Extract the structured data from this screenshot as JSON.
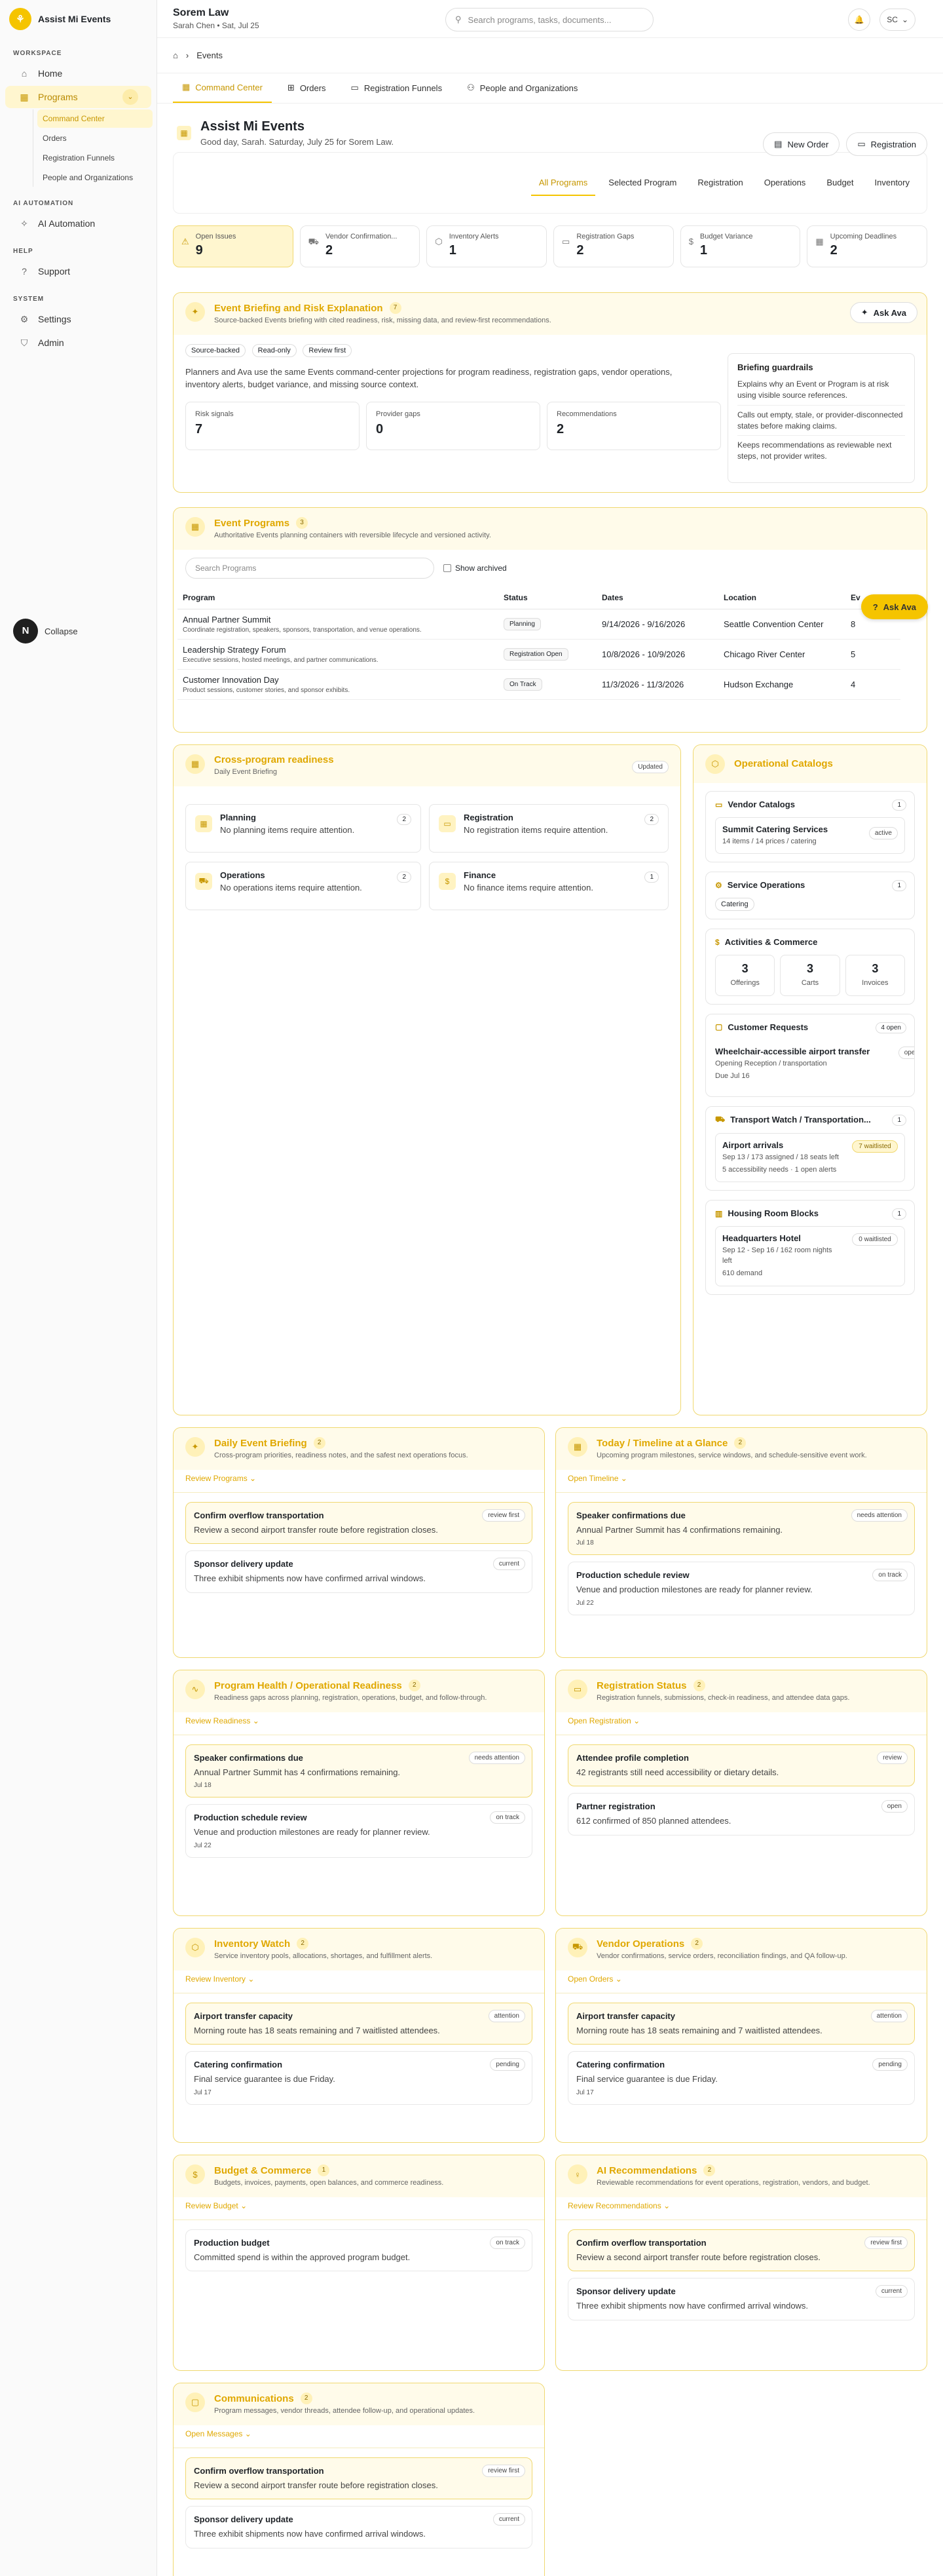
{
  "brand": "Assist Mi Events",
  "sidebar": {
    "sections": [
      "WORKSPACE",
      "AI AUTOMATION",
      "HELP",
      "SYSTEM"
    ],
    "items": [
      {
        "label": "Home",
        "icon": "home-icon"
      },
      {
        "label": "Programs",
        "icon": "calendar-icon"
      },
      {
        "label": "AI Automation",
        "icon": "ai-icon"
      },
      {
        "label": "Support",
        "icon": "help-icon"
      },
      {
        "label": "Settings",
        "icon": "gear-icon"
      },
      {
        "label": "Admin",
        "icon": "shield-icon"
      }
    ],
    "sub": [
      "Command Center",
      "Orders",
      "Registration Funnels",
      "People and Organizations"
    ],
    "collapse": "Collapse",
    "collapse_badge": "N"
  },
  "topbar": {
    "org": "Sorem Law",
    "user_date": "Sarah Chen • Sat, Jul 25",
    "search_placeholder": "Search programs, tasks, documents...",
    "avatar": "SC"
  },
  "breadcrumb": {
    "current": "Events"
  },
  "tabs": [
    "Command Center",
    "Orders",
    "Registration Funnels",
    "People and Organizations"
  ],
  "hero": {
    "title": "Assist Mi Events",
    "subtitle": "Good day, Sarah. Saturday, July 25 for Sorem Law.",
    "new_order": "New Order",
    "registration": "Registration"
  },
  "filters": [
    "All Programs",
    "Selected Program",
    "Registration",
    "Operations",
    "Budget",
    "Inventory"
  ],
  "kpis": [
    {
      "label": "Open Issues",
      "value": "9"
    },
    {
      "label": "Vendor Confirmation...",
      "value": "2"
    },
    {
      "label": "Inventory Alerts",
      "value": "1"
    },
    {
      "label": "Registration Gaps",
      "value": "2"
    },
    {
      "label": "Budget Variance",
      "value": "1"
    },
    {
      "label": "Upcoming Deadlines",
      "value": "2"
    }
  ],
  "briefing": {
    "title": "Event Briefing and Risk Explanation",
    "count": "7",
    "subtitle": "Source-backed Events briefing with cited readiness, risk, missing data, and review-first recommendations.",
    "ask": "Ask Ava",
    "chips": [
      "Source-backed",
      "Read-only",
      "Review first"
    ],
    "body": "Planners and Ava use the same Events command-center projections for program readiness, registration gaps, vendor operations, inventory alerts, budget variance, and missing source context.",
    "stats": [
      {
        "label": "Risk signals",
        "value": "7"
      },
      {
        "label": "Provider gaps",
        "value": "0"
      },
      {
        "label": "Recommendations",
        "value": "2"
      }
    ],
    "guardrails": {
      "title": "Briefing guardrails",
      "lines": [
        "Explains why an Event or Program is at risk using visible source references.",
        "Calls out empty, stale, or provider-disconnected states before making claims.",
        "Keeps recommendations as reviewable next steps, not provider writes."
      ]
    }
  },
  "programs": {
    "title": "Event Programs",
    "count": "3",
    "subtitle": "Authoritative Events planning containers with reversible lifecycle and versioned activity.",
    "search_placeholder": "Search Programs",
    "show_archived": "Show archived",
    "ask": "Ask Ava",
    "columns": [
      "Program",
      "Status",
      "Dates",
      "Location",
      "Ev"
    ],
    "rows": [
      {
        "name": "Annual Partner Summit",
        "desc": "Coordinate registration, speakers, sponsors, transportation, and venue operations.",
        "status": "Planning",
        "dates": "9/14/2026 - 9/16/2026",
        "location": "Seattle Convention Center",
        "events": "8"
      },
      {
        "name": "Leadership Strategy Forum",
        "desc": "Executive sessions, hosted meetings, and partner communications.",
        "status": "Registration Open",
        "dates": "10/8/2026 - 10/9/2026",
        "location": "Chicago River Center",
        "events": "5"
      },
      {
        "name": "Customer Innovation Day",
        "desc": "Product sessions, customer stories, and sponsor exhibits.",
        "status": "On Track",
        "dates": "11/3/2026 - 11/3/2026",
        "location": "Hudson Exchange",
        "events": "4"
      }
    ]
  },
  "readiness": {
    "title": "Cross-program readiness",
    "subtitle": "Daily Event Briefing",
    "badge": "Updated",
    "tiles": [
      {
        "title": "Planning",
        "desc": "No planning items require attention.",
        "count": "2"
      },
      {
        "title": "Registration",
        "desc": "No registration items require attention.",
        "count": "2"
      },
      {
        "title": "Operations",
        "desc": "No operations items require attention.",
        "count": "2"
      },
      {
        "title": "Finance",
        "desc": "No finance items require attention.",
        "count": "1"
      }
    ]
  },
  "catalogs": {
    "title": "Operational Catalogs",
    "vendor": {
      "title": "Vendor Catalogs",
      "n": "1",
      "item": "Summit Catering Services",
      "meta": "14 items / 14 prices / catering",
      "status": "active"
    },
    "service": {
      "title": "Service Operations",
      "n": "1",
      "chip": "Catering"
    },
    "commerce": {
      "title": "Activities & Commerce",
      "stats": [
        {
          "v": "3",
          "l": "Offerings"
        },
        {
          "v": "3",
          "l": "Carts"
        },
        {
          "v": "3",
          "l": "Invoices"
        }
      ]
    },
    "requests": {
      "title": "Customer Requests",
      "n": "4 open",
      "item": "Wheelchair-accessible airport transfer",
      "meta": "Opening Reception / transportation",
      "due": "Due Jul 16",
      "status": "open"
    },
    "transport": {
      "title": "Transport Watch / Transportation...",
      "n": "1",
      "item": "Airport arrivals",
      "meta": "Sep 13 / 173 assigned / 18 seats left",
      "extra": "5 accessibility needs · 1 open alerts",
      "badge": "7 waitlisted"
    },
    "housing": {
      "title": "Housing Room Blocks",
      "n": "1",
      "item": "Headquarters Hotel",
      "meta": "Sep 12 - Sep 16 / 162 room nights left",
      "extra": "610 demand",
      "badge": "0 waitlisted"
    }
  },
  "panels": [
    {
      "key": "daily",
      "title": "Daily Event Briefing",
      "count": "2",
      "subtitle": "Cross-program priorities, readiness notes, and the safest next operations focus.",
      "link": "Review Programs",
      "cards": [
        {
          "t": "Confirm overflow transportation",
          "d": "Review a second airport transfer route before registration closes.",
          "b": "review first",
          "hl": true
        },
        {
          "t": "Sponsor delivery update",
          "d": "Three exhibit shipments now have confirmed arrival windows.",
          "b": "current",
          "hl": false
        }
      ]
    },
    {
      "key": "today",
      "title": "Today / Timeline at a Glance",
      "count": "2",
      "subtitle": "Upcoming program milestones, service windows, and schedule-sensitive event work.",
      "link": "Open Timeline",
      "cards": [
        {
          "t": "Speaker confirmations due",
          "d": "Annual Partner Summit has 4 confirmations remaining.",
          "date": "Jul 18",
          "b": "needs attention",
          "hl": true
        },
        {
          "t": "Production schedule review",
          "d": "Venue and production milestones are ready for planner review.",
          "date": "Jul 22",
          "b": "on track",
          "hl": false
        }
      ]
    },
    {
      "key": "health",
      "title": "Program Health / Operational Readiness",
      "count": "2",
      "subtitle": "Readiness gaps across planning, registration, operations, budget, and follow-through.",
      "link": "Review Readiness",
      "cards": [
        {
          "t": "Speaker confirmations due",
          "d": "Annual Partner Summit has 4 confirmations remaining.",
          "date": "Jul 18",
          "b": "needs attention",
          "hl": true
        },
        {
          "t": "Production schedule review",
          "d": "Venue and production milestones are ready for planner review.",
          "date": "Jul 22",
          "b": "on track",
          "hl": false
        }
      ]
    },
    {
      "key": "regstatus",
      "title": "Registration Status",
      "count": "2",
      "subtitle": "Registration funnels, submissions, check-in readiness, and attendee data gaps.",
      "link": "Open Registration",
      "cards": [
        {
          "t": "Attendee profile completion",
          "d": "42 registrants still need accessibility or dietary details.",
          "b": "review",
          "hl": true
        },
        {
          "t": "Partner registration",
          "d": "612 confirmed of 850 planned attendees.",
          "b": "open",
          "hl": false
        }
      ]
    },
    {
      "key": "inventory",
      "title": "Inventory Watch",
      "count": "2",
      "subtitle": "Service inventory pools, allocations, shortages, and fulfillment alerts.",
      "link": "Review Inventory",
      "cards": [
        {
          "t": "Airport transfer capacity",
          "d": "Morning route has 18 seats remaining and 7 waitlisted attendees.",
          "b": "attention",
          "hl": true
        },
        {
          "t": "Catering confirmation",
          "d": "Final service guarantee is due Friday.",
          "date": "Jul 17",
          "b": "pending",
          "hl": false
        }
      ]
    },
    {
      "key": "vendor",
      "title": "Vendor Operations",
      "count": "2",
      "subtitle": "Vendor confirmations, service orders, reconciliation findings, and QA follow-up.",
      "link": "Open Orders",
      "cards": [
        {
          "t": "Airport transfer capacity",
          "d": "Morning route has 18 seats remaining and 7 waitlisted attendees.",
          "b": "attention",
          "hl": true
        },
        {
          "t": "Catering confirmation",
          "d": "Final service guarantee is due Friday.",
          "date": "Jul 17",
          "b": "pending",
          "hl": false
        }
      ]
    },
    {
      "key": "budget",
      "title": "Budget & Commerce",
      "count": "1",
      "subtitle": "Budgets, invoices, payments, open balances, and commerce readiness.",
      "link": "Review Budget",
      "cards": [
        {
          "t": "Production budget",
          "d": "Committed spend is within the approved program budget.",
          "b": "on track",
          "hl": false
        }
      ]
    },
    {
      "key": "ai",
      "title": "AI Recommendations",
      "count": "2",
      "subtitle": "Reviewable recommendations for event operations, registration, vendors, and budget.",
      "link": "Review Recommendations",
      "cards": [
        {
          "t": "Confirm overflow transportation",
          "d": "Review a second airport transfer route before registration closes.",
          "b": "review first",
          "hl": true
        },
        {
          "t": "Sponsor delivery update",
          "d": "Three exhibit shipments now have confirmed arrival windows.",
          "b": "current",
          "hl": false
        }
      ]
    },
    {
      "key": "comms",
      "title": "Communications",
      "count": "2",
      "subtitle": "Program messages, vendor threads, attendee follow-up, and operational updates.",
      "link": "Open Messages",
      "cards": [
        {
          "t": "Confirm overflow transportation",
          "d": "Review a second airport transfer route before registration closes.",
          "b": "review first",
          "hl": true
        },
        {
          "t": "Sponsor delivery update",
          "d": "Three exhibit shipments now have confirmed arrival windows.",
          "b": "current",
          "hl": false
        }
      ]
    }
  ]
}
